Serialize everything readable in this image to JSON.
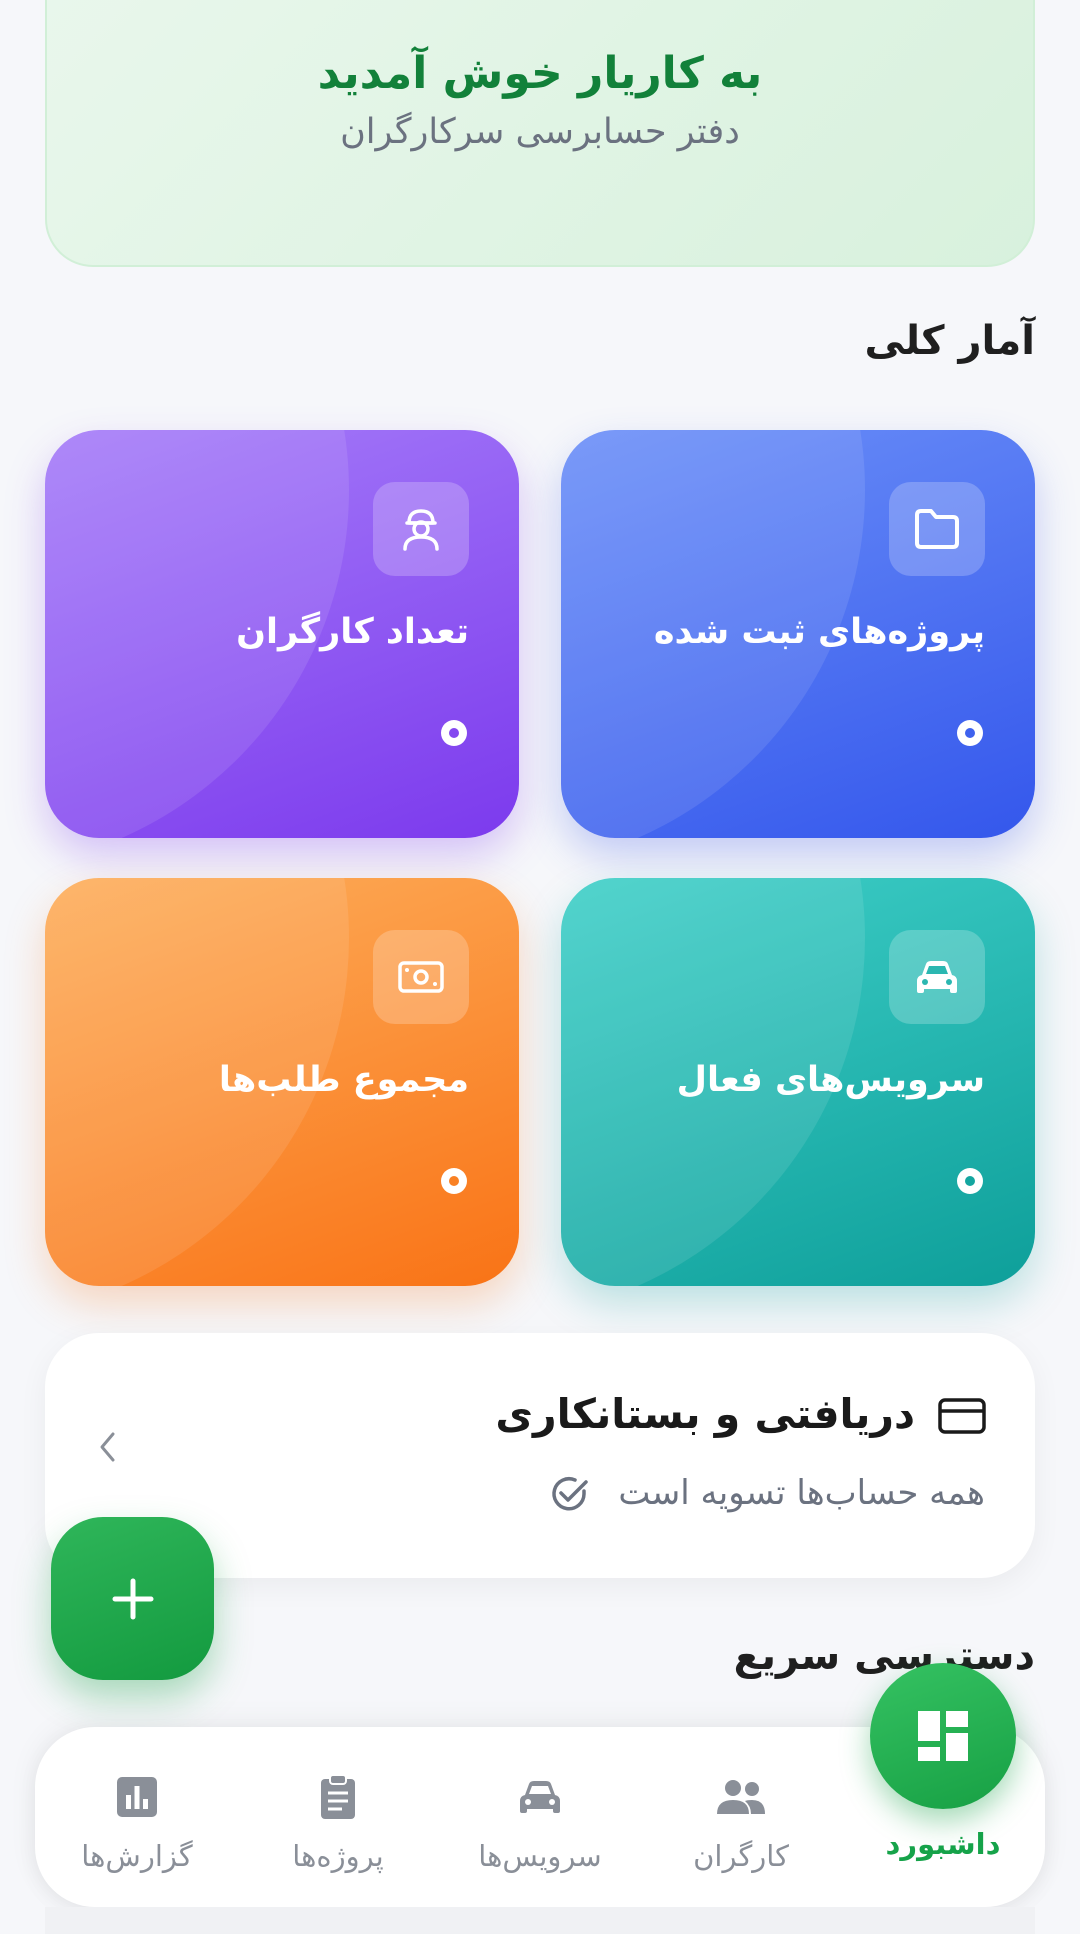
{
  "welcome": {
    "title": "به کاریار خوش آمدید",
    "subtitle": "دفتر حسابرسی سرکارگران"
  },
  "stats_section_title": "آمار کلی",
  "stats": [
    {
      "label": "پروژه‌های ثبت شده",
      "icon": "folder-icon",
      "color": "#3f62ee"
    },
    {
      "label": "تعداد کارگران",
      "icon": "worker-icon",
      "color": "#8447f0"
    },
    {
      "label": "سرویس‌های فعال",
      "icon": "car-icon",
      "color": "#14a6a0"
    },
    {
      "label": "مجموع طلب‌ها",
      "icon": "cash-icon",
      "color": "#f98124"
    }
  ],
  "balance": {
    "title": "دریافتی و بستانکاری",
    "status": "همه حساب‌ها تسویه است",
    "icon": "credit-card-icon"
  },
  "quick_access_title": "دسترسی سریع",
  "nav": {
    "items": [
      {
        "label": "داشبورد",
        "icon": "dashboard-icon",
        "active": true
      },
      {
        "label": "کارگران",
        "icon": "people-icon"
      },
      {
        "label": "سرویس‌ها",
        "icon": "car-icon"
      },
      {
        "label": "پروژه‌ها",
        "icon": "clipboard-icon"
      },
      {
        "label": "گزارش‌ها",
        "icon": "chart-icon"
      }
    ]
  },
  "colors": {
    "accent": "#16a34a",
    "background": "#f6f7fa"
  }
}
